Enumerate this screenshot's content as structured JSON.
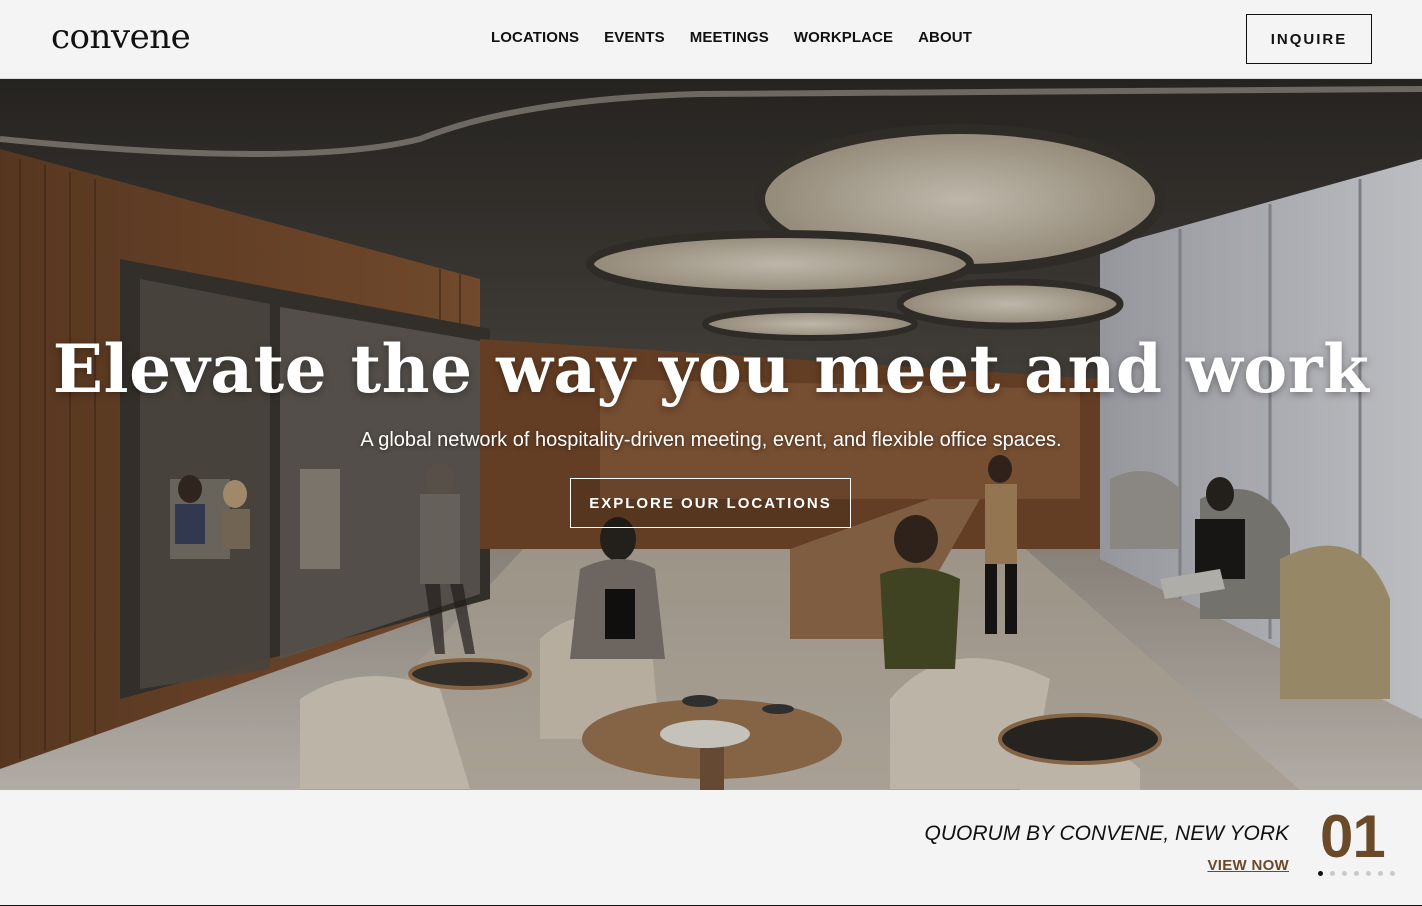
{
  "brand": {
    "logo_text": "convene"
  },
  "nav": {
    "items": [
      {
        "label": "LOCATIONS"
      },
      {
        "label": "EVENTS"
      },
      {
        "label": "MEETINGS"
      },
      {
        "label": "WORKPLACE"
      },
      {
        "label": "ABOUT"
      }
    ],
    "inquire_label": "INQUIRE"
  },
  "hero": {
    "title": "Elevate the way you meet and work",
    "subtitle": "A global network of hospitality-driven meeting, event, and flexible office spaces.",
    "cta_label": "EXPLORE OUR LOCATIONS"
  },
  "slide": {
    "location_title": "QUORUM BY CONVENE, NEW YORK",
    "link_label": "VIEW NOW",
    "number": "01",
    "total_dots": 7,
    "active_index": 0
  },
  "colors": {
    "accent_brown": "#6b4a2a",
    "text_dark": "#111111",
    "background": "#f4f4f4"
  }
}
